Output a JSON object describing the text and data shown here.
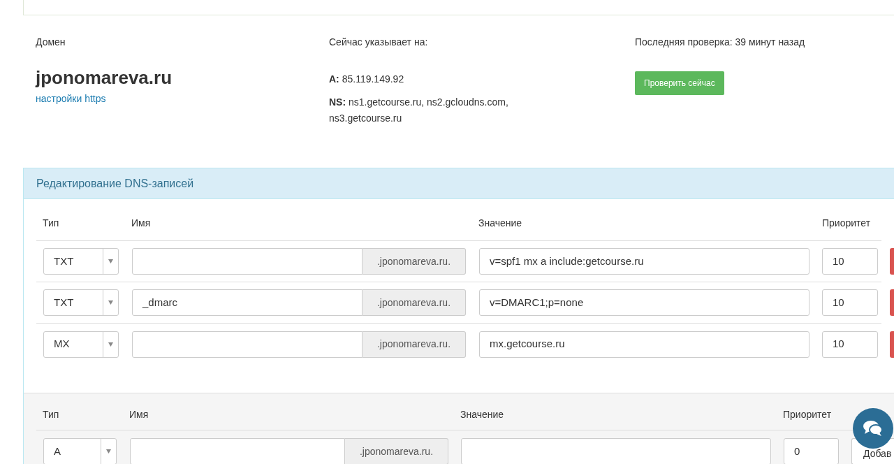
{
  "domain": {
    "label": "Домен",
    "name": "jponomareva.ru",
    "https_link": "настройки https"
  },
  "pointing": {
    "label": "Сейчас указывает на:",
    "records": [
      {
        "text": "**A:** 85.119.149.92"
      },
      {
        "text": "**NS:** ns1.getcourse.ru, ns2.gcloudns.com, ns3.getcourse.ru"
      }
    ]
  },
  "check": {
    "label": "Последняя проверка: 39 минут назад",
    "button": "Проверить сейчас"
  },
  "dns_panel": {
    "title": "Редактирование DNS-записей",
    "columns": [
      "Тип",
      "Имя",
      "Значение",
      "Приоритет"
    ],
    "rows": [
      {
        "type": "TXT",
        "name": "",
        "suffix": ".jponomareva.ru.",
        "value": "v=spf1 mx a include:getcourse.ru",
        "priority": "10"
      },
      {
        "type": "TXT",
        "name": "_dmarc",
        "suffix": ".jponomareva.ru.",
        "value": "v=DMARC1;p=none",
        "priority": "10"
      },
      {
        "type": "MX",
        "name": "",
        "suffix": ".jponomareva.ru.",
        "value": "mx.getcourse.ru",
        "priority": "10"
      }
    ]
  },
  "add_form": {
    "columns": [
      "Тип",
      "Имя",
      "Значение",
      "Приоритет"
    ],
    "type": "A",
    "suffix": ".jponomareva.ru.",
    "priority": "0",
    "button": "Добав"
  }
}
